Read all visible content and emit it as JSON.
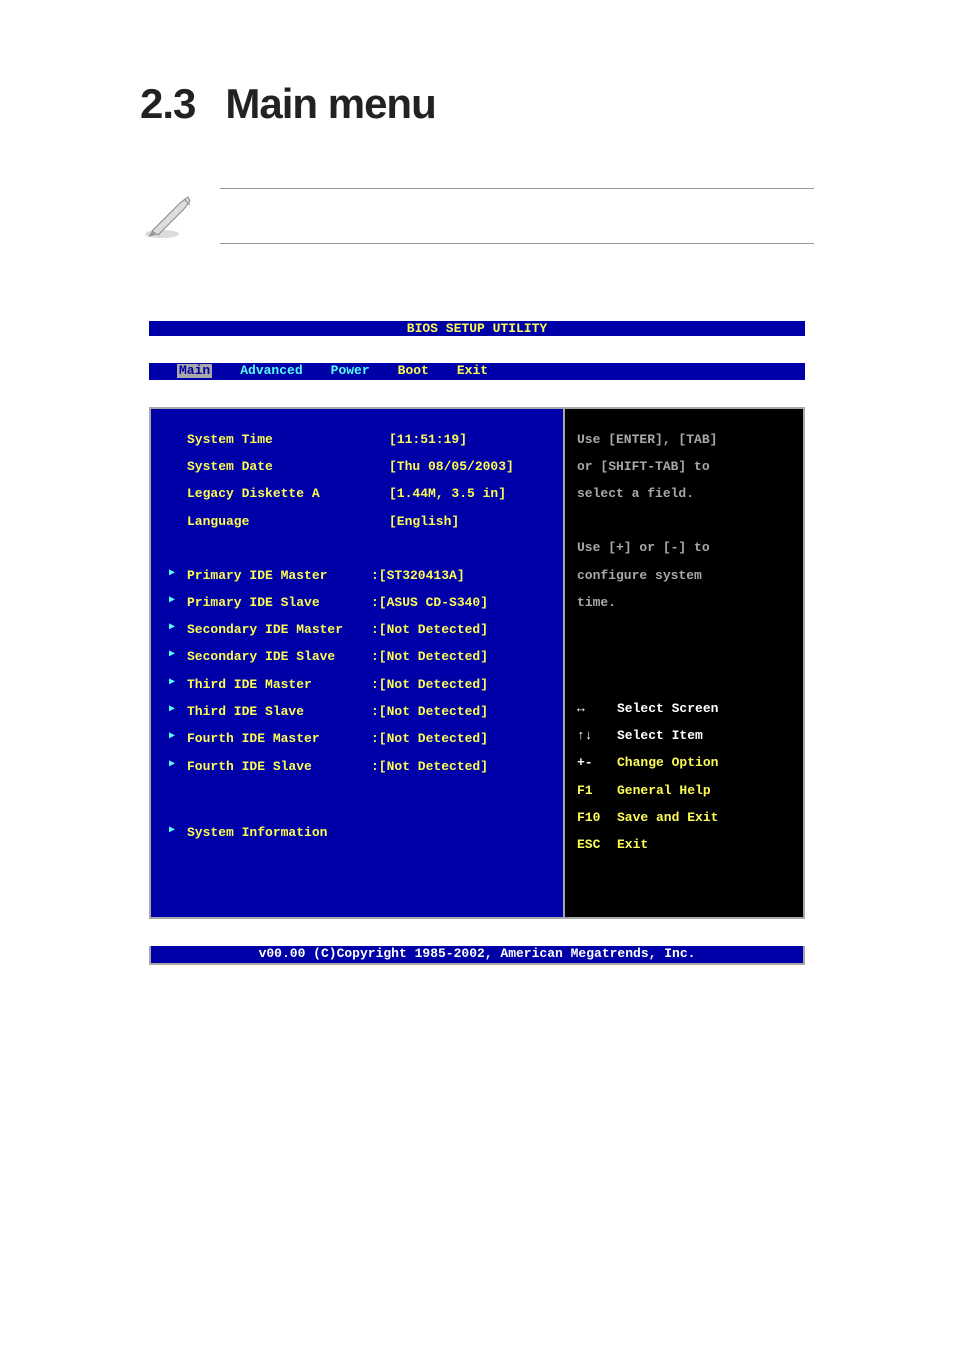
{
  "heading": {
    "num": "2.3",
    "title": "Main menu"
  },
  "bios": {
    "title": "BIOS SETUP UTILITY",
    "menu": {
      "main": "Main",
      "advanced": "Advanced",
      "power": "Power",
      "boot": "Boot",
      "exit": "Exit"
    },
    "rows": {
      "sys_time": {
        "label": "System Time",
        "value": "[11:51:19]"
      },
      "sys_date": {
        "label": "System Date",
        "value": "[Thu 08/05/2003]"
      },
      "legacy": {
        "label": "Legacy Diskette A",
        "value": "[1.44M, 3.5 in]"
      },
      "language": {
        "label": "Language",
        "value": "[English]"
      },
      "pim": {
        "label": "Primary IDE Master",
        "value": ":[ST320413A]"
      },
      "pis": {
        "label": "Primary IDE Slave",
        "value": ":[ASUS CD-S340]"
      },
      "sim": {
        "label": "Secondary IDE Master",
        "value": ":[Not Detected]"
      },
      "sis": {
        "label": "Secondary IDE Slave",
        "value": ":[Not Detected]"
      },
      "tim": {
        "label": "Third IDE Master",
        "value": ":[Not Detected]"
      },
      "tis": {
        "label": "Third IDE Slave",
        "value": ":[Not Detected]"
      },
      "fim": {
        "label": "Fourth IDE Master",
        "value": ":[Not Detected]"
      },
      "fis": {
        "label": "Fourth IDE Slave",
        "value": ":[Not Detected]"
      },
      "sysinfo": {
        "label": "System Information"
      }
    },
    "help": {
      "l1": "Use [ENTER], [TAB]",
      "l2": "or [SHIFT-TAB] to",
      "l3": "select a field.",
      "l4": "Use [+] or [-] to",
      "l5": "configure system",
      "l6": "time."
    },
    "keys": {
      "lr": {
        "k": "↔",
        "d": "Select Screen"
      },
      "ud": {
        "k": "↑↓",
        "d": "Select Item"
      },
      "pm": {
        "k": "+-",
        "d": "Change Option"
      },
      "f1": {
        "k": "F1",
        "d": "General Help"
      },
      "f10": {
        "k": "F10",
        "d": "Save and Exit"
      },
      "esc": {
        "k": "ESC",
        "d": "Exit"
      }
    },
    "footer": "v00.00 (C)Copyright 1985-2002, American Megatrends, Inc."
  }
}
